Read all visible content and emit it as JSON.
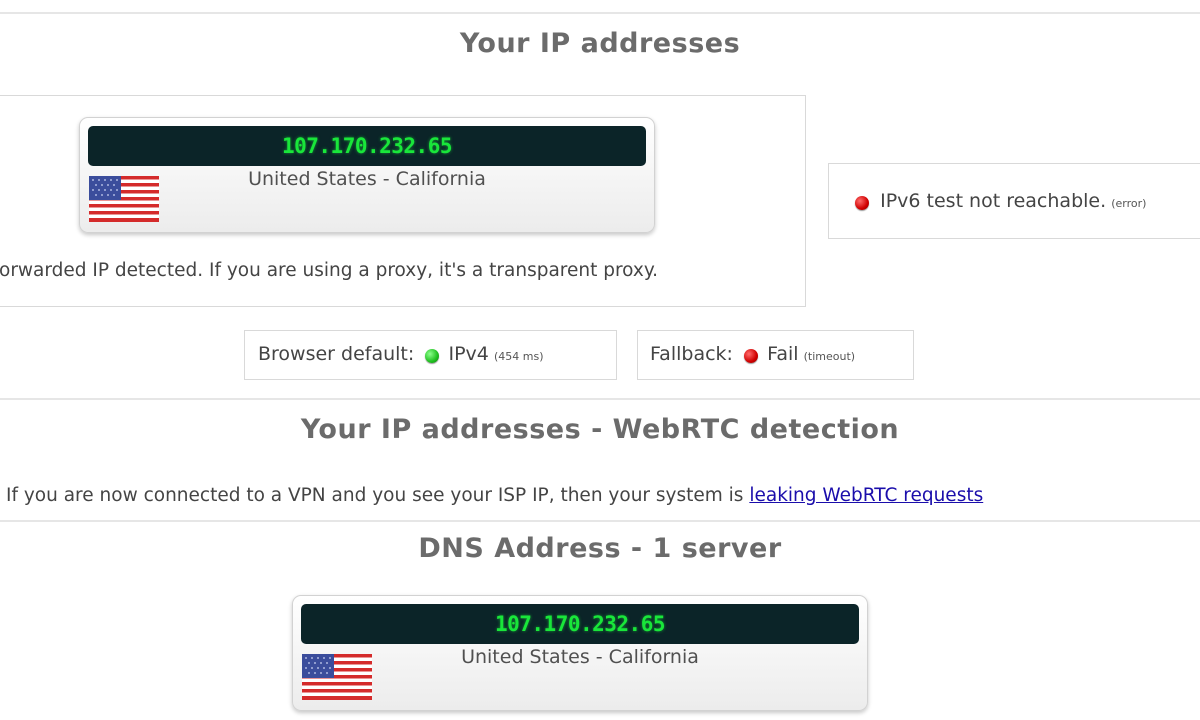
{
  "sections": {
    "ip": {
      "title": "Your IP addresses",
      "card": {
        "ip": "107.170.232.65",
        "location": "United States - California",
        "flag_icon": "us-flag-icon"
      },
      "forwarded_text": "orwarded IP detected. If you are using a proxy, it's a transparent proxy.",
      "ipv6": {
        "text": "IPv6 test not reachable.",
        "note": "(error)",
        "status_color": "#d00000"
      },
      "browser_default": {
        "label": "Browser default:",
        "value": "IPv4",
        "note": "(454 ms)",
        "status_color": "#1fbf1f"
      },
      "fallback": {
        "label": "Fallback:",
        "value": "Fail",
        "note": "(timeout)",
        "status_color": "#d00000"
      }
    },
    "webrtc": {
      "title": "Your IP addresses - WebRTC detection",
      "text": "If you are now connected to a VPN and you see your ISP IP, then your system is",
      "link": "leaking WebRTC requests"
    },
    "dns": {
      "title": "DNS Address - 1 server",
      "card": {
        "ip": "107.170.232.65",
        "location": "United States - California",
        "flag_icon": "us-flag-icon"
      }
    }
  },
  "colors": {
    "ip_text": "#19e63a",
    "ip_bar": "#0b2428",
    "heading": "#6b6b6b",
    "link": "#1a0dab"
  }
}
